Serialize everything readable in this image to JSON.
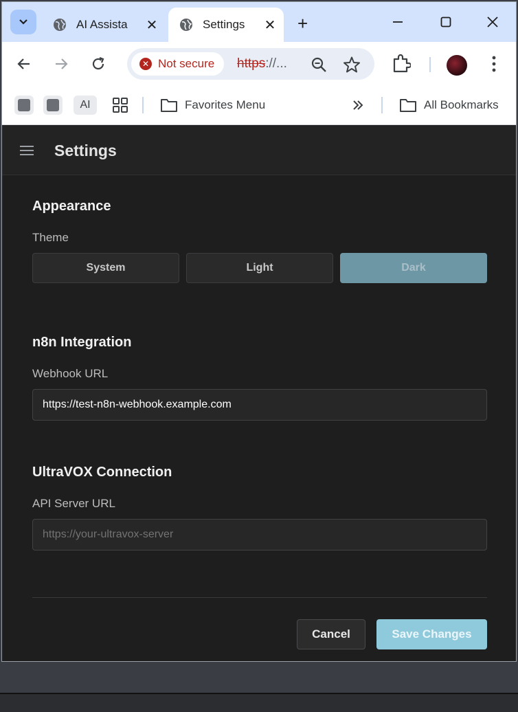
{
  "browser": {
    "tabs": [
      {
        "title": "AI Assista",
        "active": false
      },
      {
        "title": "Settings",
        "active": true
      }
    ],
    "security_chip": "Not secure",
    "url_scheme": "https",
    "url_rest": "://...",
    "bookmarks": {
      "ai_label": "AI",
      "favorites_folder": "Favorites Menu",
      "all_bookmarks": "All Bookmarks"
    }
  },
  "app": {
    "title": "Settings",
    "appearance": {
      "section_title": "Appearance",
      "theme_label": "Theme",
      "theme_options": [
        "System",
        "Light",
        "Dark"
      ],
      "selected_theme": "Dark"
    },
    "n8n": {
      "section_title": "n8n Integration",
      "webhook_label": "Webhook URL",
      "webhook_value": "https://test-n8n-webhook.example.com"
    },
    "ultravox": {
      "section_title": "UltraVOX Connection",
      "api_label": "API Server URL",
      "api_placeholder": "https://your-ultravox-server"
    },
    "actions": {
      "cancel": "Cancel",
      "save": "Save Changes"
    }
  },
  "colors": {
    "page_bg": "#1e1e1f",
    "selected_theme_bg": "#6e97a6",
    "save_bg": "#8ecadb",
    "not_secure_red": "#b3261e",
    "tabstrip_bg": "#d3e3fd"
  }
}
